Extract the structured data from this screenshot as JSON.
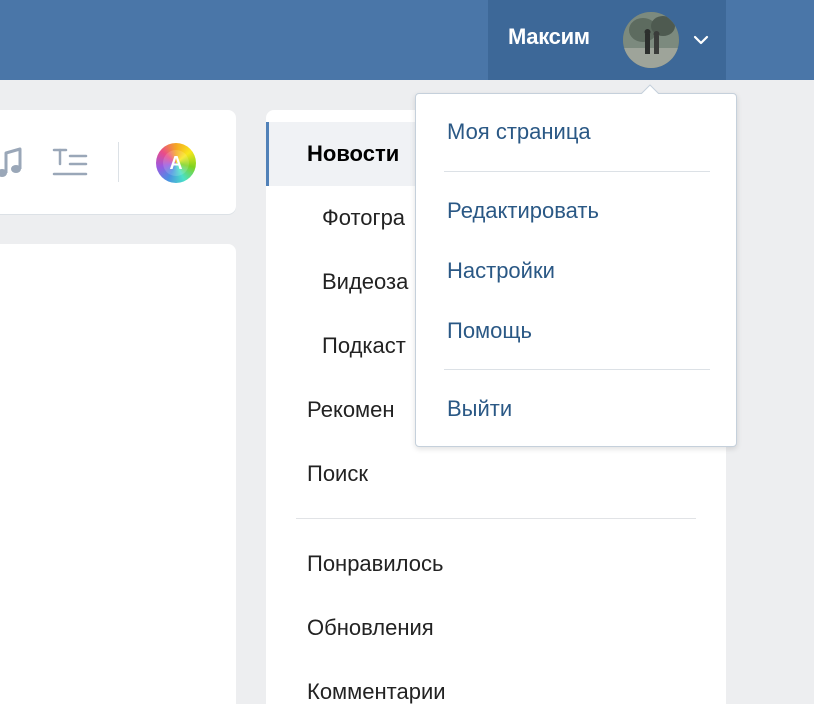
{
  "header": {
    "user_name": "Максим",
    "brand_color": "#4a76a8"
  },
  "toolbar": {
    "icons": [
      "music-icon",
      "text-format-icon",
      "color-palette-icon"
    ],
    "palette_letter": "A"
  },
  "nav": {
    "items": [
      {
        "label": "Новости",
        "active": true
      },
      {
        "label": "Фотогра",
        "sub": true
      },
      {
        "label": "Видеоза",
        "sub": true
      },
      {
        "label": "Подкаст",
        "sub": true
      },
      {
        "label": "Рекомен"
      },
      {
        "label": "Поиск"
      },
      {
        "label": "Понравилось"
      },
      {
        "label": "Обновления"
      },
      {
        "label": "Комментарии"
      }
    ]
  },
  "dropdown": {
    "items": [
      {
        "label": "Моя страница"
      },
      {
        "label": "Редактировать"
      },
      {
        "label": "Настройки"
      },
      {
        "label": "Помощь"
      },
      {
        "label": "Выйти"
      }
    ]
  }
}
